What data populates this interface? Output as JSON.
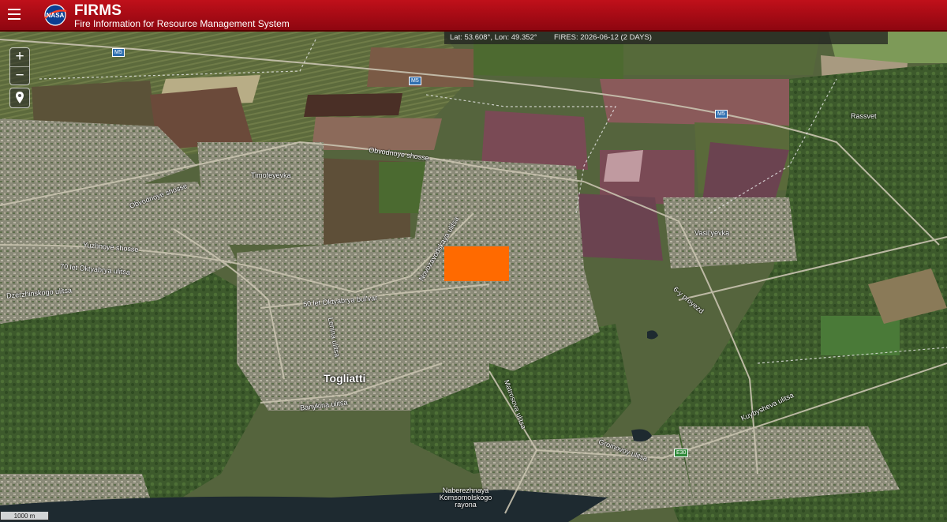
{
  "header": {
    "logo_text": "NASA",
    "title": "FIRMS",
    "subtitle": "Fire Information for Resource Management System"
  },
  "status": {
    "coords": "Lat: 53.608°, Lon: 49.352°",
    "fires": "FIRES: 2026-06-12 (2 DAYS)"
  },
  "controls": {
    "zoom_in": "+",
    "zoom_out": "−"
  },
  "scale": "1000 m",
  "map_labels": {
    "timofeyevka": "Timofeyevka",
    "obvodnoye_shosse": "Obvodnoye shosse",
    "obvodnoye_shosse_2": "Obvodnoye shosse",
    "yuzhnoye_shosse": "Yuzhnoye shosse",
    "oktyabrya_70": "70 let Oktyabrya ulitsa",
    "dzerzhinskogo": "Dzerzhinskogo ulitsa",
    "oktyabrya_50": "50 let Oktyabrya bul'var",
    "leninskaya": "Lenina ulitsa",
    "novozavodskaya": "Novozavodskaya ulitsa",
    "togliatti": "Togliatti",
    "banykina": "Banykina ulitsa",
    "matrosova": "Matrosova ulitsa",
    "gromovoy": "Gromovoy ulitsa",
    "naberezhnaya": "Naberezhnaya Komsomolskogo rayona",
    "vasilyevka": "Vasil'yevka",
    "rassvet": "Rassvet",
    "proyezd": "6-y proyezd",
    "kuybysheva": "Kuybysheva ulitsa"
  },
  "shields": {
    "m5_a": "M5",
    "m5_b": "M5",
    "m5_c": "M5",
    "e30": "E30"
  },
  "colors": {
    "header_red": "#b00c16",
    "fire_orange": "#ff6a00"
  }
}
